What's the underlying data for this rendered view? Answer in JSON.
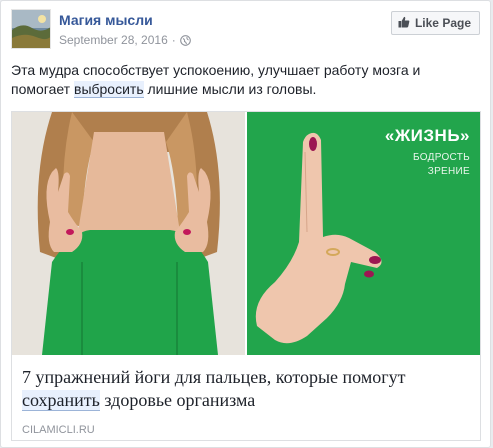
{
  "header": {
    "page_name": "Магия мысли",
    "date": "September 28, 2016",
    "separator": "·",
    "like_button_label": "Like Page"
  },
  "post": {
    "text_before": "Эта мудра способствует успокоению, улучшает работу мозга и помогает ",
    "text_highlight": "выбросить",
    "text_after": " лишние мысли из головы."
  },
  "attachment": {
    "overlay_title": "«ЖИЗНЬ»",
    "overlay_line1": "БОДРОСТЬ",
    "overlay_line2": "ЗРЕНИЕ",
    "link_title_line1": "7 упражнений йоги для пальцев, которые помогут",
    "link_title_highlight": "сохранить",
    "link_title_rest": " здоровье организма",
    "domain": "CILAMICLI.RU"
  },
  "icons": {
    "avatar": "landscape-avatar",
    "globe": "globe-icon",
    "like": "thumbs-up-icon"
  },
  "colors": {
    "link": "#365899",
    "green_bg": "#22a54c",
    "highlight": "#e8f0fd"
  }
}
